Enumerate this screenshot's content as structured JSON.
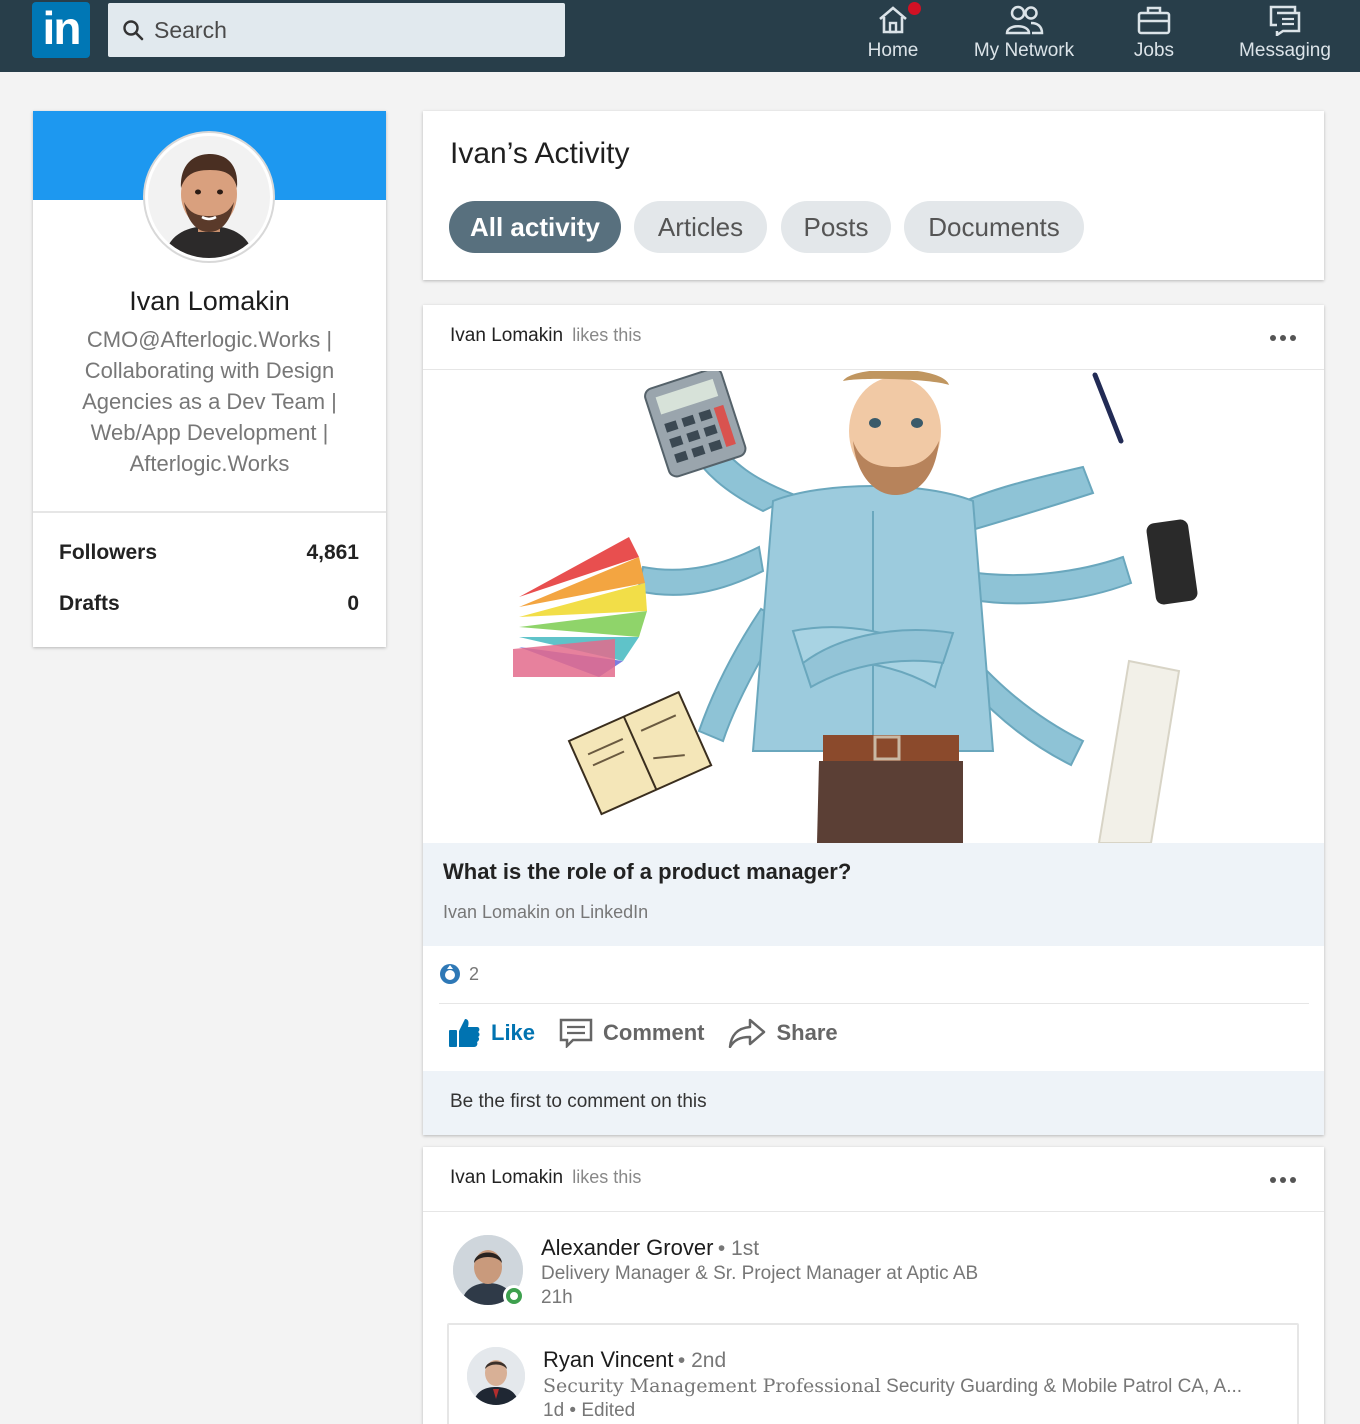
{
  "nav": {
    "logo_text": "in",
    "search_placeholder": "Search",
    "items": [
      {
        "label": "Home",
        "icon": "home-icon"
      },
      {
        "label": "My Network",
        "icon": "network-icon"
      },
      {
        "label": "Jobs",
        "icon": "briefcase-icon"
      },
      {
        "label": "Messaging",
        "icon": "messaging-icon"
      }
    ]
  },
  "profile": {
    "name": "Ivan Lomakin",
    "headline": "CMO@Afterlogic.Works | Collaborating with Design Agencies as a Dev Team | Web/App Development | Afterlogic.Works",
    "stats": [
      {
        "label": "Followers",
        "value": "4,861"
      },
      {
        "label": "Drafts",
        "value": "0"
      }
    ]
  },
  "activity": {
    "title": "Ivan’s Activity",
    "tabs": [
      "All activity",
      "Articles",
      "Posts",
      "Documents"
    ],
    "active_tab": "All activity"
  },
  "post1": {
    "actor": "Ivan Lomakin",
    "action": "likes this",
    "article_title": "What is the role of a product manager?",
    "article_source": "Ivan Lomakin on LinkedIn",
    "reaction_count": "2",
    "actions": {
      "like": "Like",
      "comment": "Comment",
      "share": "Share"
    },
    "comment_prompt": "Be the first to comment on this"
  },
  "post2": {
    "actor": "Ivan Lomakin",
    "action": "likes this",
    "author": {
      "name": "Alexander Grover",
      "degree": "• 1st",
      "headline": "Delivery Manager & Sr. Project Manager at Aptic AB",
      "time": "21h"
    },
    "nested_author": {
      "name": "Ryan Vincent",
      "degree": "• 2nd",
      "headline_styled": "Security Management Professional",
      "headline": "Security Guarding & Mobile Patrol CA, A...",
      "time": "1d • Edited"
    }
  },
  "colors": {
    "nav_bg": "#283e4a",
    "brand_blue": "#0077b5",
    "cover_blue": "#1d98f0",
    "active_pill": "#58707e",
    "like_blue": "#0073b1",
    "online_green": "#3ea04e"
  }
}
